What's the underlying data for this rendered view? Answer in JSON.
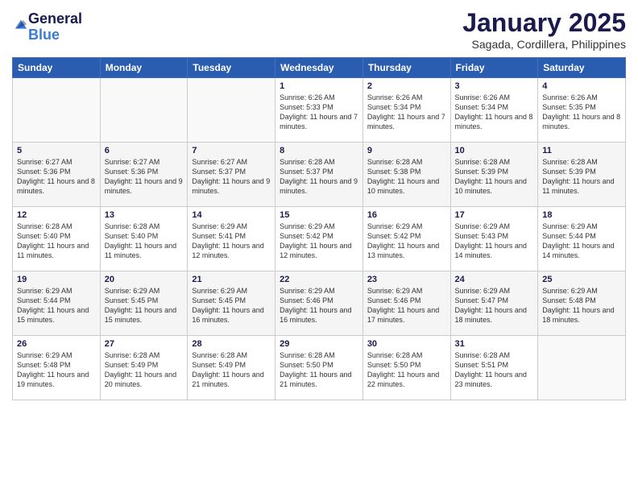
{
  "logo": {
    "general": "General",
    "blue": "Blue"
  },
  "title": "January 2025",
  "location": "Sagada, Cordillera, Philippines",
  "days_of_week": [
    "Sunday",
    "Monday",
    "Tuesday",
    "Wednesday",
    "Thursday",
    "Friday",
    "Saturday"
  ],
  "weeks": [
    [
      {
        "day": "",
        "info": ""
      },
      {
        "day": "",
        "info": ""
      },
      {
        "day": "",
        "info": ""
      },
      {
        "day": "1",
        "info": "Sunrise: 6:26 AM\nSunset: 5:33 PM\nDaylight: 11 hours\nand 7 minutes."
      },
      {
        "day": "2",
        "info": "Sunrise: 6:26 AM\nSunset: 5:34 PM\nDaylight: 11 hours\nand 7 minutes."
      },
      {
        "day": "3",
        "info": "Sunrise: 6:26 AM\nSunset: 5:34 PM\nDaylight: 11 hours\nand 8 minutes."
      },
      {
        "day": "4",
        "info": "Sunrise: 6:26 AM\nSunset: 5:35 PM\nDaylight: 11 hours\nand 8 minutes."
      }
    ],
    [
      {
        "day": "5",
        "info": "Sunrise: 6:27 AM\nSunset: 5:36 PM\nDaylight: 11 hours\nand 8 minutes."
      },
      {
        "day": "6",
        "info": "Sunrise: 6:27 AM\nSunset: 5:36 PM\nDaylight: 11 hours\nand 9 minutes."
      },
      {
        "day": "7",
        "info": "Sunrise: 6:27 AM\nSunset: 5:37 PM\nDaylight: 11 hours\nand 9 minutes."
      },
      {
        "day": "8",
        "info": "Sunrise: 6:28 AM\nSunset: 5:37 PM\nDaylight: 11 hours\nand 9 minutes."
      },
      {
        "day": "9",
        "info": "Sunrise: 6:28 AM\nSunset: 5:38 PM\nDaylight: 11 hours\nand 10 minutes."
      },
      {
        "day": "10",
        "info": "Sunrise: 6:28 AM\nSunset: 5:39 PM\nDaylight: 11 hours\nand 10 minutes."
      },
      {
        "day": "11",
        "info": "Sunrise: 6:28 AM\nSunset: 5:39 PM\nDaylight: 11 hours\nand 11 minutes."
      }
    ],
    [
      {
        "day": "12",
        "info": "Sunrise: 6:28 AM\nSunset: 5:40 PM\nDaylight: 11 hours\nand 11 minutes."
      },
      {
        "day": "13",
        "info": "Sunrise: 6:28 AM\nSunset: 5:40 PM\nDaylight: 11 hours\nand 11 minutes."
      },
      {
        "day": "14",
        "info": "Sunrise: 6:29 AM\nSunset: 5:41 PM\nDaylight: 11 hours\nand 12 minutes."
      },
      {
        "day": "15",
        "info": "Sunrise: 6:29 AM\nSunset: 5:42 PM\nDaylight: 11 hours\nand 12 minutes."
      },
      {
        "day": "16",
        "info": "Sunrise: 6:29 AM\nSunset: 5:42 PM\nDaylight: 11 hours\nand 13 minutes."
      },
      {
        "day": "17",
        "info": "Sunrise: 6:29 AM\nSunset: 5:43 PM\nDaylight: 11 hours\nand 14 minutes."
      },
      {
        "day": "18",
        "info": "Sunrise: 6:29 AM\nSunset: 5:44 PM\nDaylight: 11 hours\nand 14 minutes."
      }
    ],
    [
      {
        "day": "19",
        "info": "Sunrise: 6:29 AM\nSunset: 5:44 PM\nDaylight: 11 hours\nand 15 minutes."
      },
      {
        "day": "20",
        "info": "Sunrise: 6:29 AM\nSunset: 5:45 PM\nDaylight: 11 hours\nand 15 minutes."
      },
      {
        "day": "21",
        "info": "Sunrise: 6:29 AM\nSunset: 5:45 PM\nDaylight: 11 hours\nand 16 minutes."
      },
      {
        "day": "22",
        "info": "Sunrise: 6:29 AM\nSunset: 5:46 PM\nDaylight: 11 hours\nand 16 minutes."
      },
      {
        "day": "23",
        "info": "Sunrise: 6:29 AM\nSunset: 5:46 PM\nDaylight: 11 hours\nand 17 minutes."
      },
      {
        "day": "24",
        "info": "Sunrise: 6:29 AM\nSunset: 5:47 PM\nDaylight: 11 hours\nand 18 minutes."
      },
      {
        "day": "25",
        "info": "Sunrise: 6:29 AM\nSunset: 5:48 PM\nDaylight: 11 hours\nand 18 minutes."
      }
    ],
    [
      {
        "day": "26",
        "info": "Sunrise: 6:29 AM\nSunset: 5:48 PM\nDaylight: 11 hours\nand 19 minutes."
      },
      {
        "day": "27",
        "info": "Sunrise: 6:28 AM\nSunset: 5:49 PM\nDaylight: 11 hours\nand 20 minutes."
      },
      {
        "day": "28",
        "info": "Sunrise: 6:28 AM\nSunset: 5:49 PM\nDaylight: 11 hours\nand 21 minutes."
      },
      {
        "day": "29",
        "info": "Sunrise: 6:28 AM\nSunset: 5:50 PM\nDaylight: 11 hours\nand 21 minutes."
      },
      {
        "day": "30",
        "info": "Sunrise: 6:28 AM\nSunset: 5:50 PM\nDaylight: 11 hours\nand 22 minutes."
      },
      {
        "day": "31",
        "info": "Sunrise: 6:28 AM\nSunset: 5:51 PM\nDaylight: 11 hours\nand 23 minutes."
      },
      {
        "day": "",
        "info": ""
      }
    ]
  ]
}
